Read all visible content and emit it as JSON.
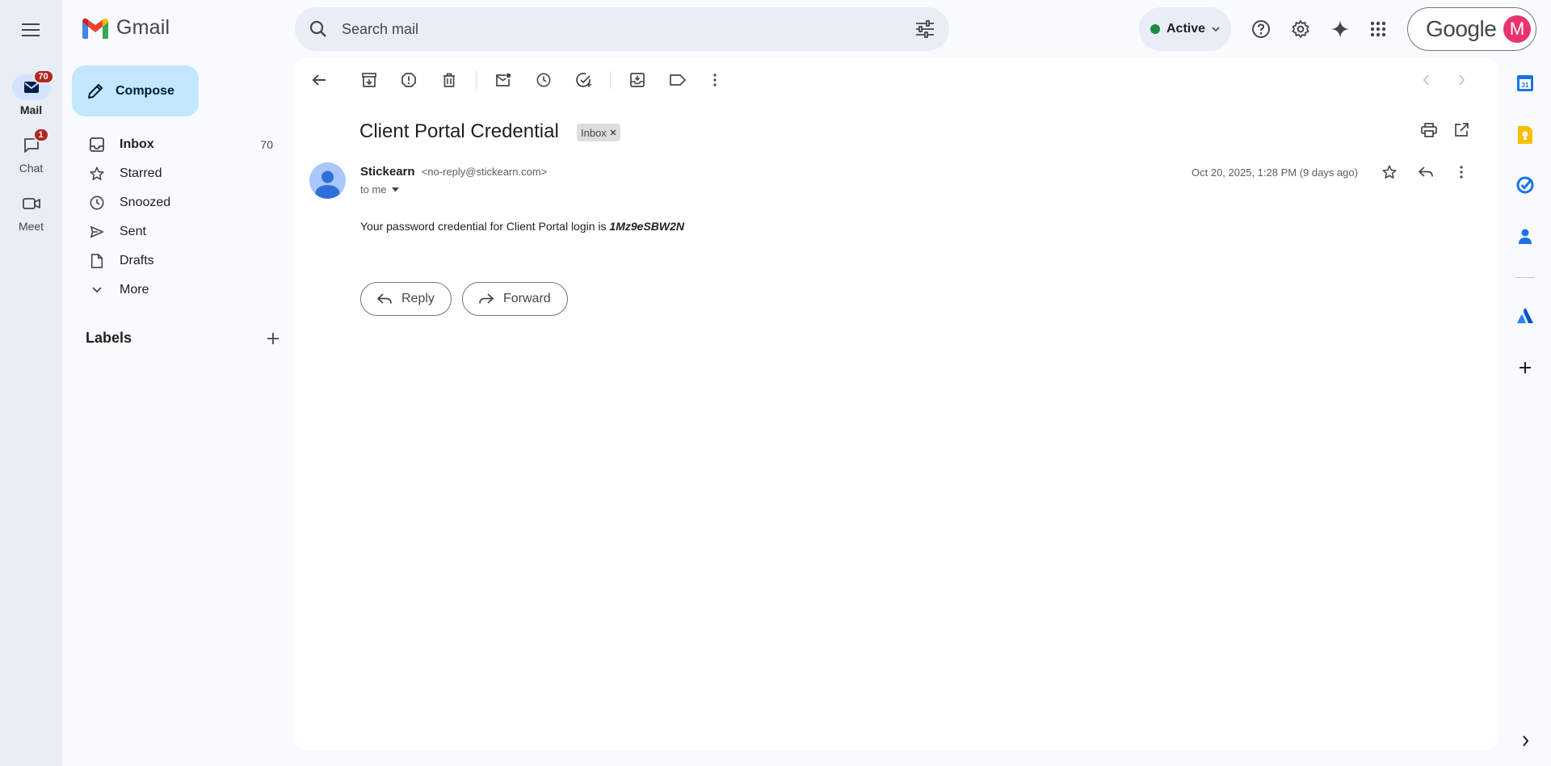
{
  "app": {
    "name": "Gmail"
  },
  "rail": {
    "items": [
      {
        "label": "Mail",
        "badge": "70"
      },
      {
        "label": "Chat",
        "badge": "1"
      },
      {
        "label": "Meet",
        "badge": ""
      }
    ]
  },
  "compose": {
    "label": "Compose"
  },
  "nav": {
    "items": [
      {
        "label": "Inbox",
        "count": "70"
      },
      {
        "label": "Starred",
        "count": ""
      },
      {
        "label": "Snoozed",
        "count": ""
      },
      {
        "label": "Sent",
        "count": ""
      },
      {
        "label": "Drafts",
        "count": ""
      },
      {
        "label": "More",
        "count": ""
      }
    ],
    "labels_header": "Labels"
  },
  "search": {
    "placeholder": "Search mail"
  },
  "status": {
    "label": "Active",
    "color": "#1e8e3e"
  },
  "account": {
    "brand": "Google",
    "initial": "M",
    "avatar_color": "#e8336d"
  },
  "email": {
    "subject": "Client Portal Credential",
    "label_chip": "Inbox",
    "sender_name": "Stickearn",
    "sender_email": "<no-reply@stickearn.com>",
    "to": "to me",
    "date": "Oct 20, 2025, 1:28 PM (9 days ago)",
    "body_prefix": "Your password credential for Client Portal login is ",
    "credential": "1Mz9eSBW2N",
    "reply_label": "Reply",
    "forward_label": "Forward"
  },
  "colors": {
    "accent": "#0b57d0",
    "compose_bg": "#c2e7ff",
    "rail_bg": "#e9eef6",
    "badge": "#b3261e"
  }
}
